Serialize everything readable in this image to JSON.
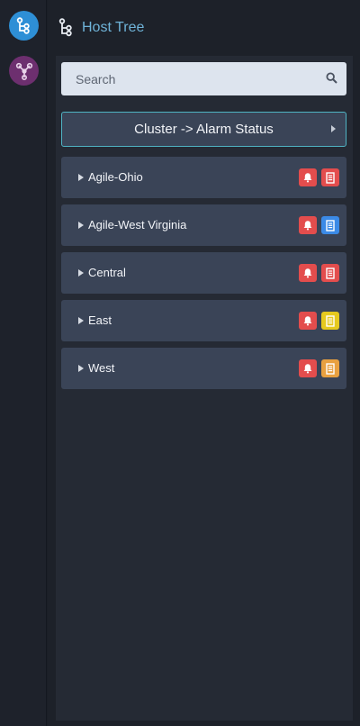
{
  "rail": {
    "items": [
      {
        "icon": "host-tree-icon",
        "color": "#2e8fd6"
      },
      {
        "icon": "topology-icon",
        "color": "#6d2f6f"
      }
    ]
  },
  "header": {
    "icon": "host-tree-icon",
    "title": "Host Tree"
  },
  "search": {
    "placeholder": "Search",
    "value": "",
    "icon": "search-icon"
  },
  "cluster_button": {
    "label": "Cluster -> Alarm Status"
  },
  "clusters": [
    {
      "name": "Agile-Ohio",
      "alarm_color": "#e34d4d",
      "doc_color": "#e34d4d"
    },
    {
      "name": "Agile-West Virginia",
      "alarm_color": "#e34d4d",
      "doc_color": "#3b8ae6"
    },
    {
      "name": "Central",
      "alarm_color": "#e34d4d",
      "doc_color": "#e34d4d"
    },
    {
      "name": "East",
      "alarm_color": "#e34d4d",
      "doc_color": "#e6c91e"
    },
    {
      "name": "West",
      "alarm_color": "#e34d4d",
      "doc_color": "#e8a040"
    }
  ]
}
